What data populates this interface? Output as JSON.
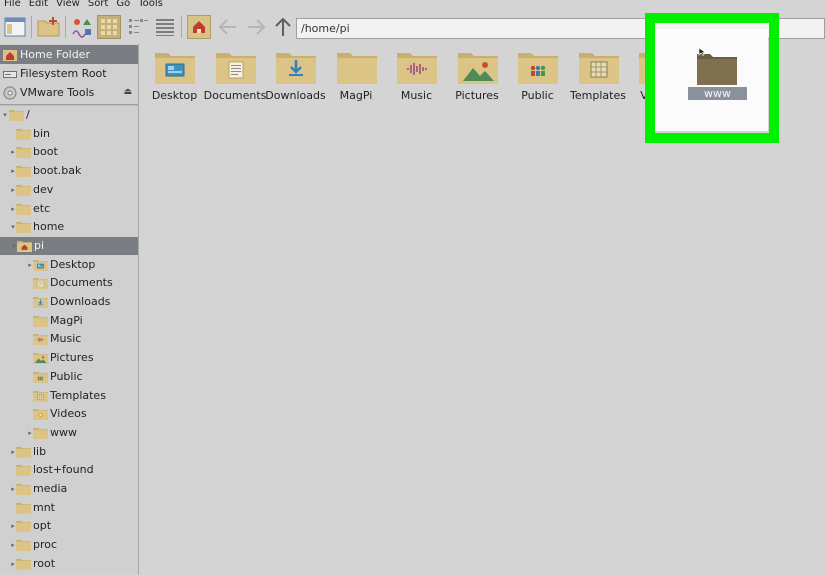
{
  "menu": [
    "File",
    "Edit",
    "View",
    "Sort",
    "Go",
    "Tools"
  ],
  "toolbar": {
    "path": "/home/pi",
    "icons": [
      "new-window-icon",
      "new-folder-icon",
      "thumbnail-view-icon",
      "icon-view-icon",
      "compact-view-icon",
      "detailed-list-icon",
      "home-icon",
      "back-arrow-icon",
      "forward-arrow-icon",
      "up-arrow-icon"
    ]
  },
  "sidebar": {
    "places": [
      {
        "label": "Home Folder",
        "icon": "home-icon",
        "selected": true
      },
      {
        "label": "Filesystem Root",
        "icon": "drive-icon",
        "selected": false
      },
      {
        "label": "VMware Tools",
        "icon": "disc-icon",
        "selected": false,
        "eject": "⏏"
      }
    ],
    "tree": [
      {
        "label": "/",
        "expander": "▾",
        "kind": "folder"
      },
      {
        "label": "bin",
        "expander": "",
        "kind": "folder"
      },
      {
        "label": "boot",
        "expander": "▸",
        "kind": "folder"
      },
      {
        "label": "boot.bak",
        "expander": "▸",
        "kind": "folder"
      },
      {
        "label": "dev",
        "expander": "▸",
        "kind": "folder"
      },
      {
        "label": "etc",
        "expander": "▸",
        "kind": "folder"
      },
      {
        "label": "home",
        "expander": "▾",
        "kind": "folder"
      },
      {
        "label": "pi",
        "expander": "▾",
        "kind": "home",
        "selected": true
      },
      {
        "label": "Desktop",
        "expander": "▸",
        "kind": "desktop"
      },
      {
        "label": "Documents",
        "expander": "",
        "kind": "documents"
      },
      {
        "label": "Downloads",
        "expander": "",
        "kind": "downloads"
      },
      {
        "label": "MagPi",
        "expander": "",
        "kind": "folder"
      },
      {
        "label": "Music",
        "expander": "",
        "kind": "music"
      },
      {
        "label": "Pictures",
        "expander": "",
        "kind": "pictures"
      },
      {
        "label": "Public",
        "expander": "",
        "kind": "public"
      },
      {
        "label": "Templates",
        "expander": "",
        "kind": "templates"
      },
      {
        "label": "Videos",
        "expander": "",
        "kind": "videos"
      },
      {
        "label": "www",
        "expander": "▸",
        "kind": "folder"
      },
      {
        "label": "lib",
        "expander": "▸",
        "kind": "folder"
      },
      {
        "label": "lost+found",
        "expander": "",
        "kind": "folder"
      },
      {
        "label": "media",
        "expander": "▸",
        "kind": "folder"
      },
      {
        "label": "mnt",
        "expander": "",
        "kind": "folder"
      },
      {
        "label": "opt",
        "expander": "▸",
        "kind": "folder"
      },
      {
        "label": "proc",
        "expander": "▸",
        "kind": "folder"
      },
      {
        "label": "root",
        "expander": "▸",
        "kind": "folder"
      }
    ]
  },
  "content": {
    "items": [
      {
        "label": "Desktop",
        "kind": "desktop"
      },
      {
        "label": "Documents",
        "kind": "documents"
      },
      {
        "label": "Downloads",
        "kind": "downloads"
      },
      {
        "label": "MagPi",
        "kind": "folder"
      },
      {
        "label": "Music",
        "kind": "music"
      },
      {
        "label": "Pictures",
        "kind": "pictures"
      },
      {
        "label": "Public",
        "kind": "public"
      },
      {
        "label": "Templates",
        "kind": "templates"
      },
      {
        "label": "Videos",
        "kind": "videos"
      }
    ],
    "selected_item": {
      "label": "www",
      "kind": "folder-dark"
    }
  },
  "colors": {
    "folder": "#dcc487",
    "folder_dark": "#7f7150",
    "selection": "#7a7d81",
    "highlight": "#00f000"
  }
}
